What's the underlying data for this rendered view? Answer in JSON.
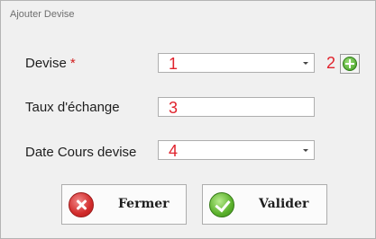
{
  "window": {
    "title": "Ajouter Devise"
  },
  "form": {
    "devise": {
      "label": "Devise",
      "required_mark": "*",
      "value": "1",
      "annotation": "2"
    },
    "taux": {
      "label": "Taux d'échange",
      "value": "3"
    },
    "date": {
      "label": "Date Cours devise",
      "value": "4"
    }
  },
  "buttons": {
    "close_label": "Fermer",
    "validate_label": "Valider"
  },
  "icons": {
    "add": "add-icon",
    "close": "close-icon",
    "validate": "check-icon"
  },
  "colors": {
    "annotation": "#e0232d",
    "required": "#d21e1e"
  }
}
